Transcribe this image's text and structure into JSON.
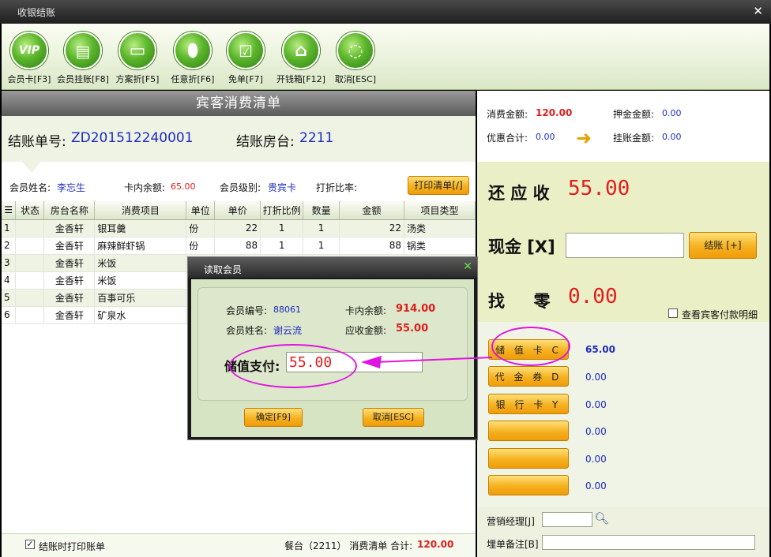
{
  "window": {
    "title": "收银结账"
  },
  "toolbar": [
    {
      "label": "会员卡[F3]",
      "icon": "vip-card-icon",
      "glyph": "VIP"
    },
    {
      "label": "会员挂账[F8]",
      "icon": "member-credit-icon",
      "glyph": "▤"
    },
    {
      "label": "方案折[F5]",
      "icon": "scheme-discount-icon",
      "glyph": "▭"
    },
    {
      "label": "任意折[F6]",
      "icon": "arbitrary-discount-icon",
      "glyph": "⬮"
    },
    {
      "label": "免单[F7]",
      "icon": "free-order-icon",
      "glyph": "☑"
    },
    {
      "label": "开钱箱[F12]",
      "icon": "cash-drawer-icon",
      "glyph": "⌂"
    },
    {
      "label": "取消[ESC]",
      "icon": "cancel-icon",
      "glyph": "◌"
    }
  ],
  "left": {
    "header": "宾客消费清单",
    "bill_no_label": "结账单号:",
    "bill_no": "ZD201512240001",
    "room_label": "结账房台:",
    "room": "2211",
    "member_name_label": "会员姓名:",
    "member_name": "李忘生",
    "card_balance_label": "卡内余额:",
    "card_balance": "65.00",
    "member_level_label": "会员级别:",
    "member_level": "贵宾卡",
    "discount_label": "打折比率:",
    "print_list_button": "打印清单[/]"
  },
  "table": {
    "columns": [
      "状态",
      "房台名称",
      "消费项目",
      "单位",
      "单价",
      "打折比例",
      "数量",
      "金额",
      "项目类型"
    ],
    "rows": [
      {
        "no": "1",
        "status": "",
        "room": "金香轩",
        "item": "银耳羹",
        "unit": "份",
        "price": "22",
        "disc": "1",
        "qty": "1",
        "amount": "22",
        "type": "汤类"
      },
      {
        "no": "2",
        "status": "",
        "room": "金香轩",
        "item": "麻辣鲜虾锅",
        "unit": "份",
        "price": "88",
        "disc": "1",
        "qty": "1",
        "amount": "88",
        "type": "锅类"
      },
      {
        "no": "3",
        "status": "",
        "room": "金香轩",
        "item": "米饭",
        "unit": "",
        "price": "",
        "disc": "",
        "qty": "",
        "amount": "",
        "type": ""
      },
      {
        "no": "4",
        "status": "",
        "room": "金香轩",
        "item": "米饭",
        "unit": "",
        "price": "",
        "disc": "",
        "qty": "",
        "amount": "",
        "type": ""
      },
      {
        "no": "5",
        "status": "",
        "room": "金香轩",
        "item": "百事可乐",
        "unit": "",
        "price": "",
        "disc": "",
        "qty": "",
        "amount": "",
        "type": ""
      },
      {
        "no": "6",
        "status": "",
        "room": "金香轩",
        "item": "矿泉水",
        "unit": "",
        "price": "",
        "disc": "",
        "qty": "",
        "amount": "",
        "type": ""
      }
    ]
  },
  "footer": {
    "print_on_checkout": "结账时打印账单",
    "summary_prefix": "餐台（2211） 消费清单 合计:",
    "total": "120.00"
  },
  "right": {
    "consume_label": "消费金额:",
    "consume": "120.00",
    "deposit_label": "押金金额:",
    "deposit": "0.00",
    "discount_total_label": "优惠合计:",
    "discount_total": "0.00",
    "credit_label": "挂账金额:",
    "credit": "0.00",
    "due_label": "还 应 收",
    "due": "55.00",
    "cash_label": "现金 [X]",
    "cash_value": "",
    "checkout_button": "结账 [+]",
    "change_label": "找     零",
    "change": "0.00",
    "view_payment_detail": "查看宾客付款明细",
    "payments": [
      {
        "label": "储 值 卡 C",
        "value": "65.00"
      },
      {
        "label": "代 金 券 D",
        "value": "0.00"
      },
      {
        "label": "银 行 卡 Y",
        "value": "0.00"
      },
      {
        "label": "",
        "value": "0.00"
      },
      {
        "label": "",
        "value": "0.00"
      },
      {
        "label": "",
        "value": "0.00"
      }
    ],
    "sales_manager_label": "营销经理[J]",
    "sales_manager_value": "",
    "bill_note_label": "埋单备注[B]",
    "bill_note_value": ""
  },
  "dialog": {
    "title": "读取会员",
    "member_no_label": "会员编号:",
    "member_no": "88061",
    "balance_label": "卡内余额:",
    "balance": "914.00",
    "member_name_label": "会员姓名:",
    "member_name": "谢云流",
    "receivable_label": "应收金额:",
    "receivable": "55.00",
    "stored_pay_label": "储值支付:",
    "stored_pay_value": "55.00",
    "ok_button": "确定[F9]",
    "cancel_button": "取消[ESC]"
  },
  "colors": {
    "accent_green": "#5cb62c",
    "orange": "#f5b120",
    "red": "#e11d1d",
    "blue": "#1f2bbe",
    "annotation": "#e014e0"
  }
}
